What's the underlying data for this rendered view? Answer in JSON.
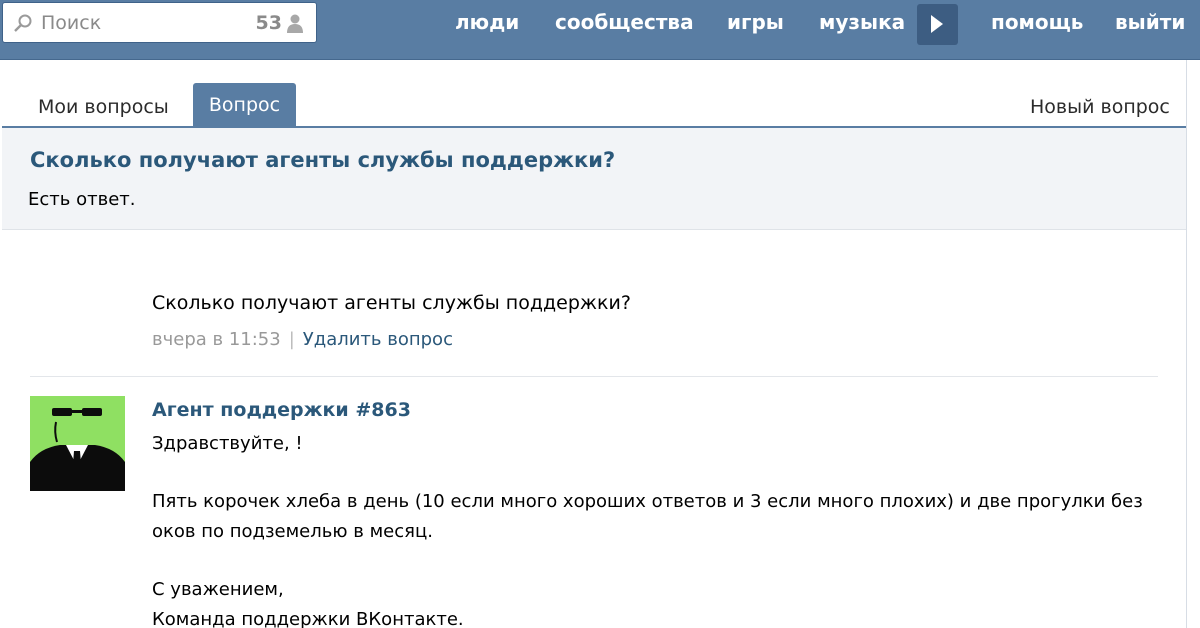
{
  "header": {
    "search": {
      "placeholder": "Поиск",
      "count": "53"
    },
    "nav": [
      "люди",
      "сообщества",
      "игры",
      "музыка",
      "помощь",
      "выйти"
    ]
  },
  "tabs": {
    "my_questions": "Мои вопросы",
    "question": "Вопрос",
    "new_question": "Новый вопрос"
  },
  "question": {
    "title": "Сколько получают агенты службы поддержки?",
    "status": "Есть ответ.",
    "text": "Сколько получают агенты службы поддержки?",
    "time": "вчера в 11:53",
    "separator": "|",
    "delete_label": "Удалить вопрос"
  },
  "answer": {
    "author": "Агент поддержки #863",
    "greeting": "Здравствуйте,          !",
    "body_line1": "Пять корочек хлеба в день (10 если много хороших ответов и 3 если много плохих) и две прогулки без",
    "body_line2": "оков по подземелью в месяц.",
    "closing": "С уважением,",
    "signature": "Команда поддержки ВКонтакте."
  },
  "colors": {
    "header_bg": "#597da3",
    "link": "#2b587a",
    "avatar_bg": "#8fe062"
  }
}
